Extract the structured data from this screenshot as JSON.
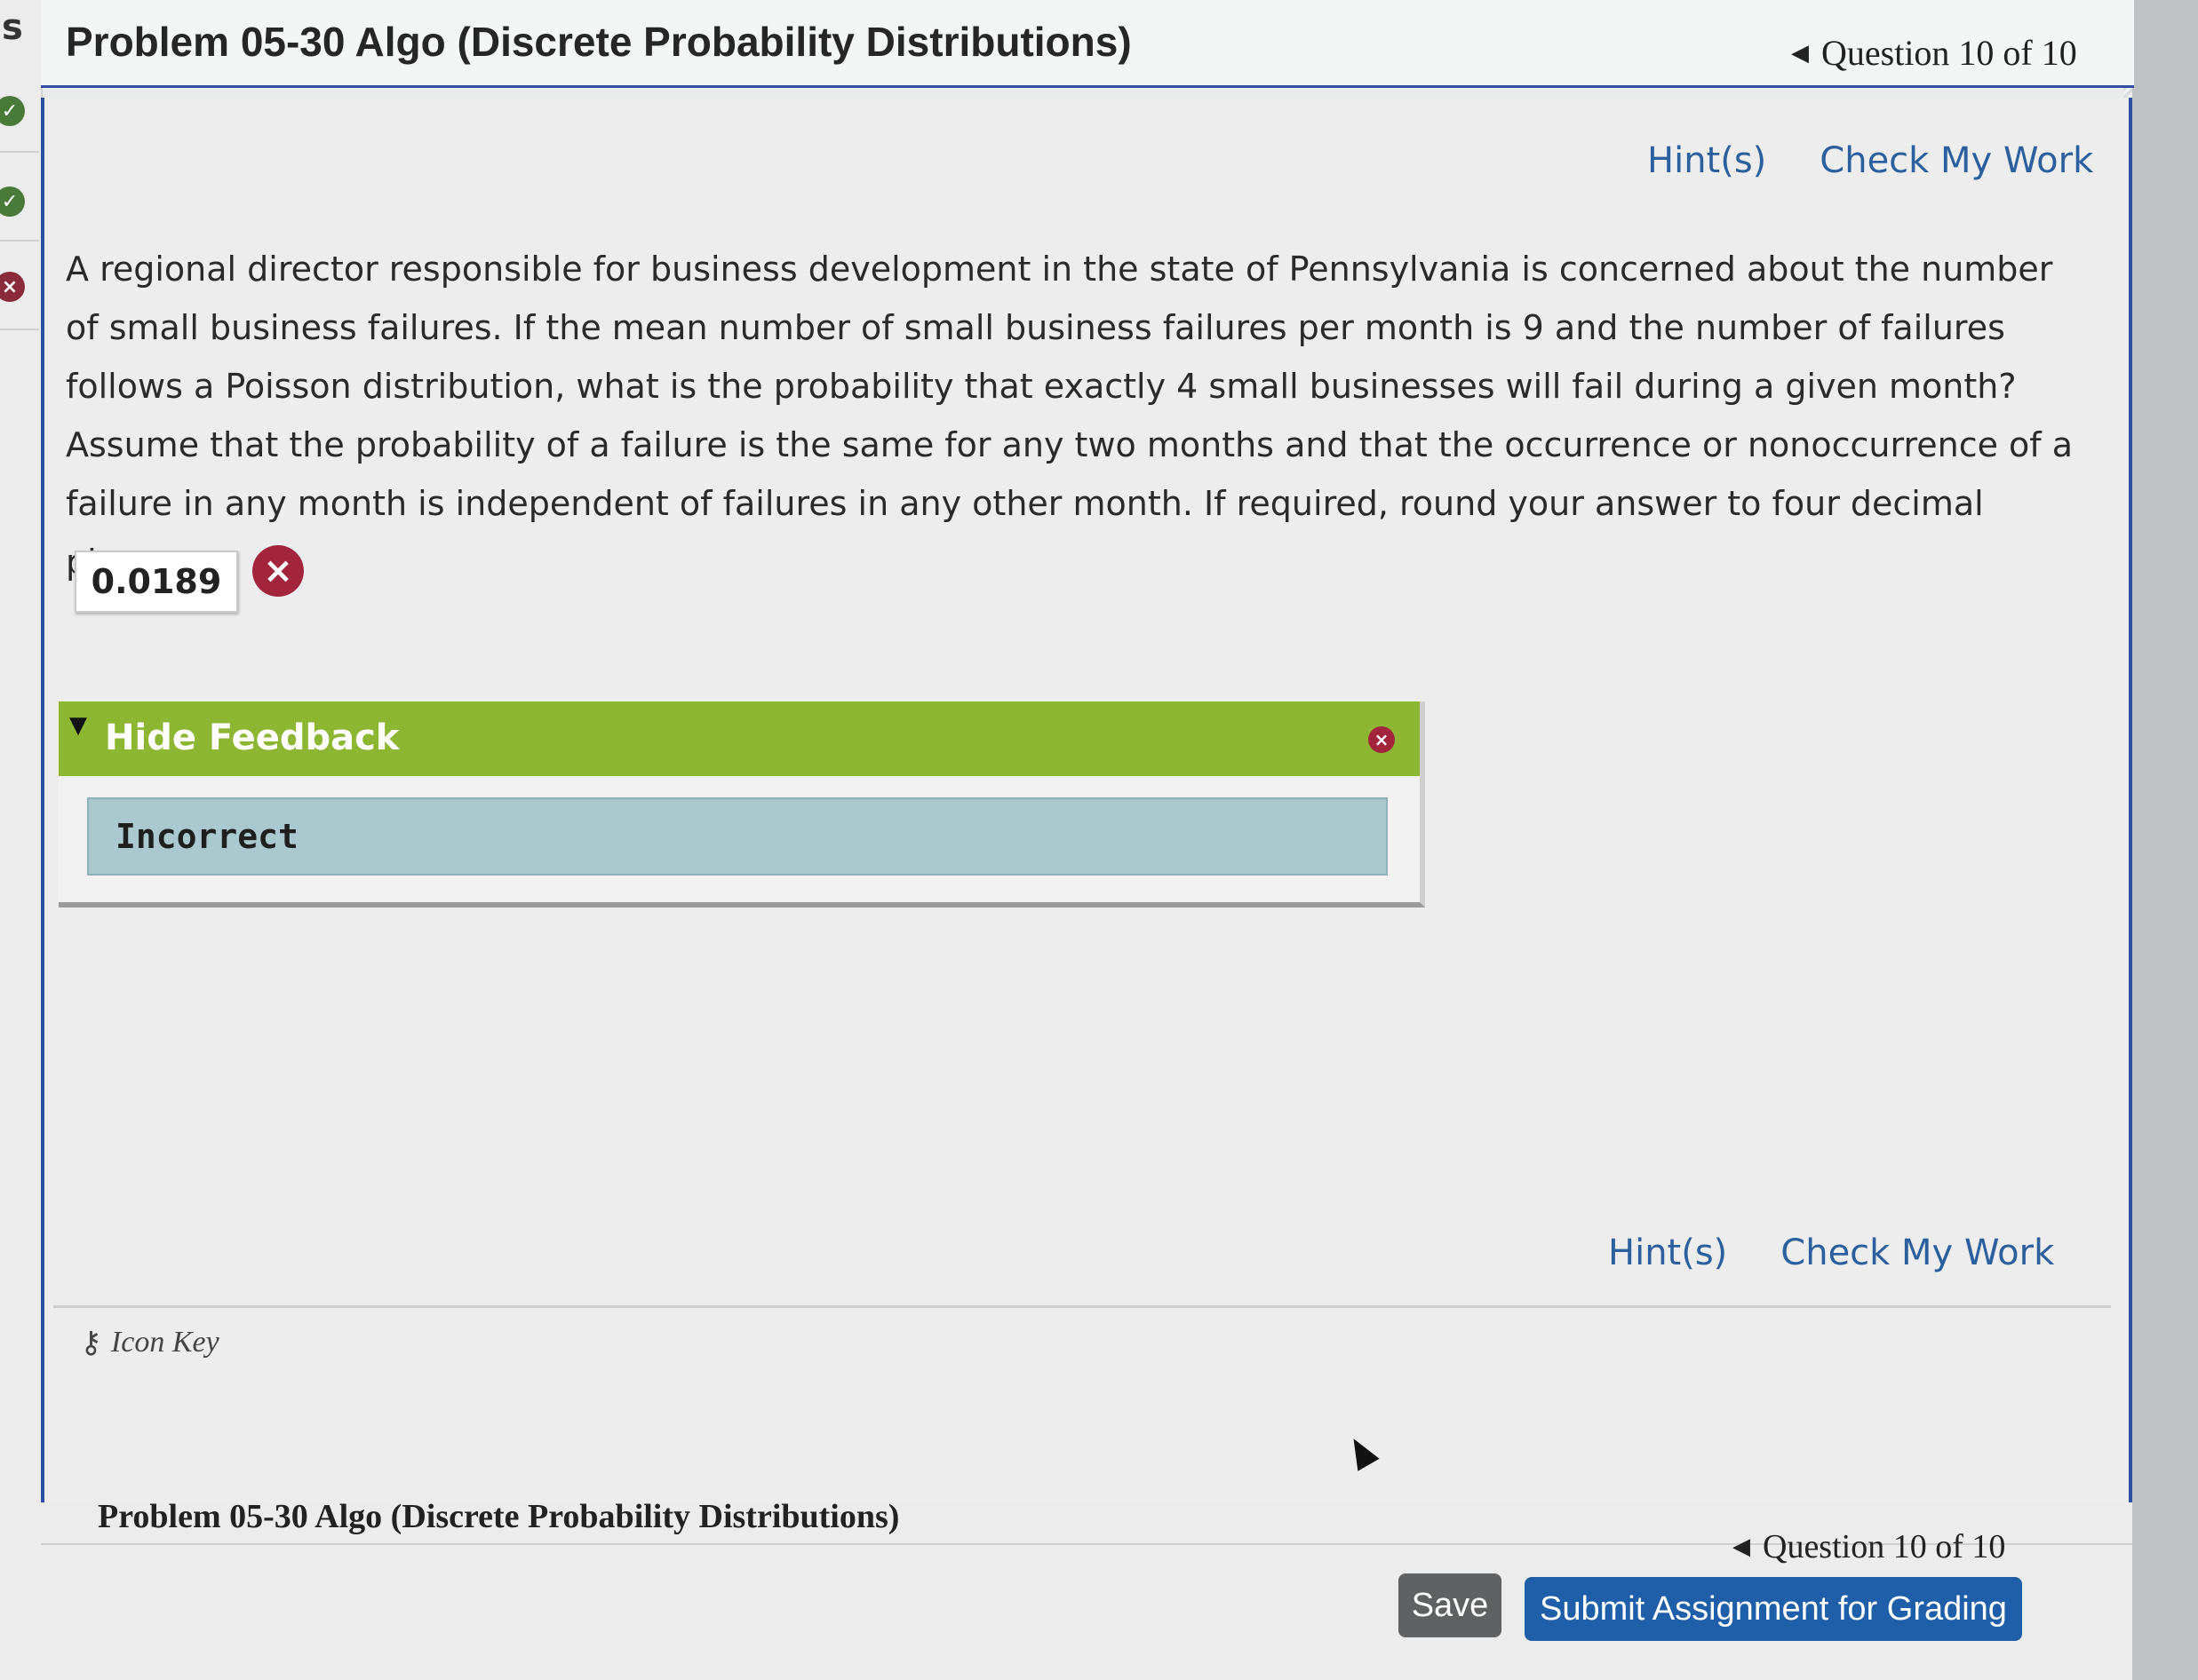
{
  "sidebar": {
    "letter": "s",
    "statuses": [
      "correct",
      "correct",
      "incorrect"
    ]
  },
  "header": {
    "title": "Problem 05-30 Algo (Discrete Probability Distributions)",
    "nav_label": "Question 10 of 10"
  },
  "links": {
    "hint": "Hint(s)",
    "check": "Check My Work"
  },
  "question": {
    "text": "A regional director responsible for business development in the state of Pennsylvania is concerned about the number of small business failures. If the mean number of small business failures per month is 9 and the number of failures follows a Poisson distribution, what is the probability that exactly 4 small businesses will fail during a given month? Assume that the probability of a failure is the same for any two months and that the occurrence or nonoccurrence of a failure in any month is independent of failures in any other month. If required, round your answer to four decimal places."
  },
  "answer": {
    "value": "0.0189",
    "status": "incorrect"
  },
  "feedback": {
    "toggle_label": "Hide Feedback",
    "result": "Incorrect"
  },
  "icon_key": {
    "label": "Icon Key"
  },
  "footer": {
    "title": "Problem 05-30 Algo (Discrete Probability Distributions)",
    "nav_label": "Question 10 of 10",
    "save_label": "Save",
    "submit_label": "Submit Assignment for Grading"
  },
  "colors": {
    "accent_blue": "#2f4fa0",
    "link_blue": "#2c5f9e",
    "feedback_green": "#8db733",
    "incorrect_red": "#a3253d",
    "feedback_body": "#a9c9cf",
    "submit_blue": "#1f5ea8"
  }
}
